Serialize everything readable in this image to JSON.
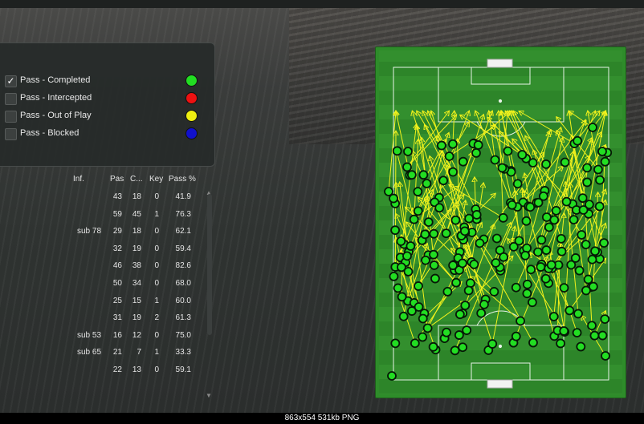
{
  "legend": {
    "items": [
      {
        "label": "Pass - Completed",
        "color": "#22dd22",
        "checked": true
      },
      {
        "label": "Pass - Intercepted",
        "color": "#ee1111",
        "checked": false
      },
      {
        "label": "Pass - Out of Play",
        "color": "#eeee11",
        "checked": false
      },
      {
        "label": "Pass - Blocked",
        "color": "#1111cc",
        "checked": false
      }
    ]
  },
  "table": {
    "headers": {
      "inf": "Inf.",
      "pas": "Pas",
      "c": "C...",
      "key": "Key",
      "pass_pct": "Pass %"
    },
    "rows": [
      {
        "inf": "",
        "pas": "43",
        "c": "18",
        "key": "0",
        "pct": "41.9"
      },
      {
        "inf": "",
        "pas": "59",
        "c": "45",
        "key": "1",
        "pct": "76.3"
      },
      {
        "inf": "sub 78",
        "pas": "29",
        "c": "18",
        "key": "0",
        "pct": "62.1"
      },
      {
        "inf": "",
        "pas": "32",
        "c": "19",
        "key": "0",
        "pct": "59.4"
      },
      {
        "inf": "",
        "pas": "46",
        "c": "38",
        "key": "0",
        "pct": "82.6"
      },
      {
        "inf": "",
        "pas": "50",
        "c": "34",
        "key": "0",
        "pct": "68.0"
      },
      {
        "inf": "",
        "pas": "25",
        "c": "15",
        "key": "1",
        "pct": "60.0"
      },
      {
        "inf": "",
        "pas": "31",
        "c": "19",
        "key": "2",
        "pct": "61.3"
      },
      {
        "inf": "sub 53",
        "pas": "16",
        "c": "12",
        "key": "0",
        "pct": "75.0"
      },
      {
        "inf": "sub 65",
        "pas": "21",
        "c": "7",
        "key": "1",
        "pct": "33.3"
      },
      {
        "inf": "",
        "pas": "22",
        "c": "13",
        "key": "0",
        "pct": "59.1"
      }
    ]
  },
  "pitch": {
    "pass_color": "#f2f21c",
    "player_color": "#22dd22"
  },
  "caption": "863x554  531kb  PNG"
}
